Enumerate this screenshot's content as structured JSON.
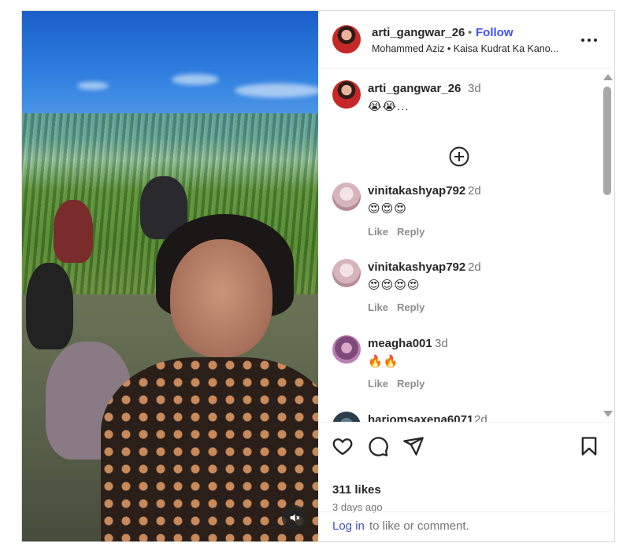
{
  "post": {
    "username": "arti_gangwar_26",
    "separator": "•",
    "follow_label": "Follow",
    "audio": "Mohammed Aziz • Kaisa Kudrat Ka Kano...",
    "mute_icon": "muted-speaker-icon"
  },
  "caption": {
    "username": "arti_gangwar_26",
    "time": "3d",
    "text": "😭😭..."
  },
  "comments": [
    {
      "username": "vinitakashyap792",
      "time": "2d",
      "text": "😍😍😍",
      "like_label": "Like",
      "reply_label": "Reply"
    },
    {
      "username": "vinitakashyap792",
      "time": "2d",
      "text": "😍😍😍😍",
      "like_label": "Like",
      "reply_label": "Reply"
    },
    {
      "username": "meagha001",
      "time": "3d",
      "text": "🔥🔥",
      "like_label": "Like",
      "reply_label": "Reply"
    },
    {
      "username": "hariomsaxena6071",
      "time": "2d"
    }
  ],
  "footer": {
    "likes": "311 likes",
    "ago": "3 days ago",
    "login_link": "Log in",
    "login_rest": "to like or comment."
  },
  "colors": {
    "follow": "#4150f7",
    "login_link": "#3f51b5",
    "muted_text": "#737373"
  }
}
